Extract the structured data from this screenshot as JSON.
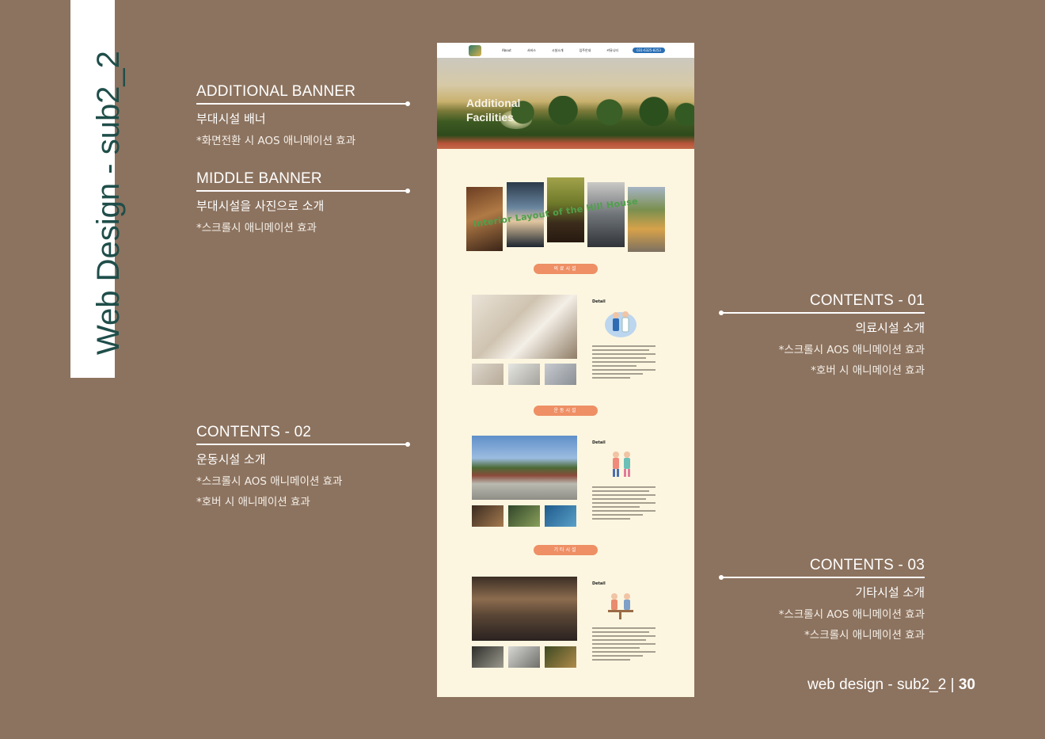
{
  "side_title": "Web Design - sub2_2",
  "annotations": {
    "additional_banner": {
      "heading": "ADDITIONAL BANNER",
      "sub": "부대시설 배너",
      "notes": [
        "*화면전환 시 AOS 애니메이션 효과"
      ]
    },
    "middle_banner": {
      "heading": "MIDDLE BANNER",
      "sub": "부대시설을 사진으로 소개",
      "notes": [
        "*스크롤시 애니메이션 효과"
      ]
    },
    "contents_01": {
      "heading": "CONTENTS - 01",
      "sub": "의료시설 소개",
      "notes": [
        "*스크롤시 AOS 애니메이션 효과",
        "*호버 시 애니메이션 효과"
      ]
    },
    "contents_02": {
      "heading": "CONTENTS - 02",
      "sub": "운동시설 소개",
      "notes": [
        "*스크롤시 AOS 애니메이션 효과",
        "*호버 시 애니메이션 효과"
      ]
    },
    "contents_03": {
      "heading": "CONTENTS - 03",
      "sub": "기타시설 소개",
      "notes": [
        "*스크롤시 AOS 애니메이션 효과",
        "*스크롤시 애니메이션 효과"
      ]
    }
  },
  "footer": {
    "label": "web design - sub2_2 |",
    "page": "30"
  },
  "mockup": {
    "nav": {
      "items": [
        "About",
        "서비스",
        "시설소개",
        "입주안내",
        "커뮤니티"
      ],
      "phone": "031-6325-8253"
    },
    "banner_title_line1": "Additional",
    "banner_title_line2": "Facilities",
    "collage_title": "Interior Layout of the Hill House",
    "sections": [
      {
        "pill": "의료시설",
        "detail": "Detail"
      },
      {
        "pill": "운동시설",
        "detail": "Detail"
      },
      {
        "pill": "기타시설",
        "detail": "Detail"
      }
    ]
  }
}
